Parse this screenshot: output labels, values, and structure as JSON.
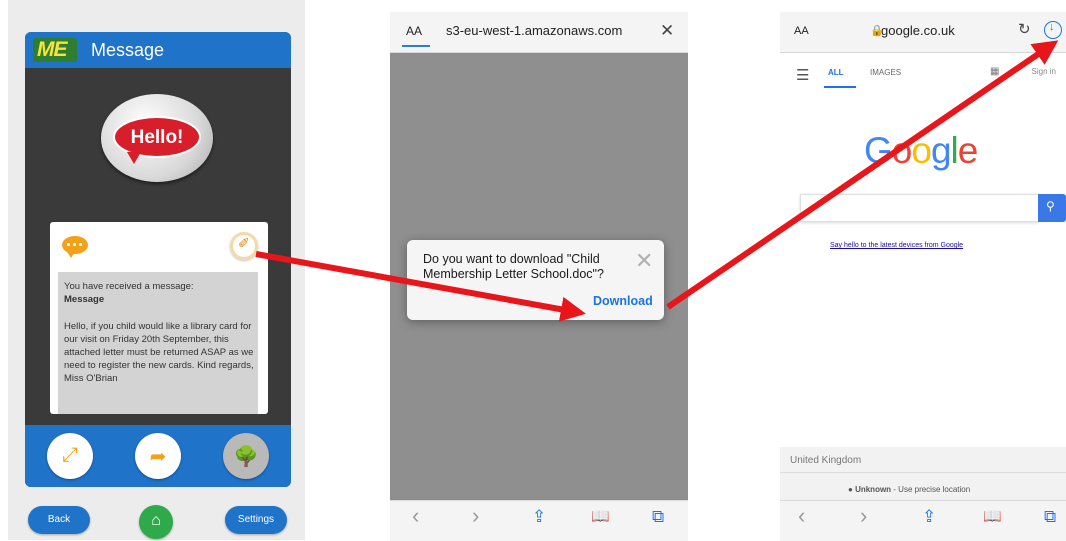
{
  "school_app": {
    "logo_text": "ME",
    "header_title": "Message",
    "hello_badge": "Hello!",
    "attachment_icon": "paperclip-icon",
    "message_heading": "You have received a message:",
    "message_subject": "Message",
    "message_body": "Hello, if you child would like a library card for our visit on Friday 20th September, this attached letter must be returned ASAP as we need to register the new cards. Kind regards, Miss O'Brian",
    "toolbar_icons": [
      "fullscreen-icon",
      "share-icon",
      "tree-icon"
    ],
    "nav": {
      "back": "Back",
      "home_icon": "home-icon",
      "settings": "Settings"
    },
    "colors": {
      "header": "#1f73c9",
      "frame": "#3a3a3a",
      "home": "#2faa4a",
      "hello": "#d81e2a"
    }
  },
  "download_browser": {
    "text_size": "AA",
    "url": "s3-eu-west-1.amazonaws.com",
    "close_icon": "close-icon",
    "dialog_message": "Do you want to download \"Child Membership Letter School.doc\"?",
    "download_label": "Download",
    "toolbar": {
      "back": "‹",
      "forward": "›",
      "share": "⇪",
      "bookmarks": "📖",
      "tabs": "⧉"
    }
  },
  "google_browser": {
    "text_size": "AA",
    "url": "google.co.uk",
    "tabs": [
      "ALL",
      "IMAGES"
    ],
    "sign_in": "Sign in",
    "logo_letters": [
      "G",
      "o",
      "o",
      "g",
      "l",
      "e"
    ],
    "logo_colors": [
      "#4285f4",
      "#ea4335",
      "#fbbc05",
      "#4285f4",
      "#34a853",
      "#ea4335"
    ],
    "promo": "Say hello to the latest devices from Google",
    "country": "United Kingdom",
    "location_status": "Unknown",
    "location_hint": " - Use precise location",
    "toolbar": {
      "back": "‹",
      "forward": "›",
      "share": "⇪",
      "bookmarks": "📖",
      "tabs": "⧉"
    }
  },
  "annotation_color": "#e8151b"
}
